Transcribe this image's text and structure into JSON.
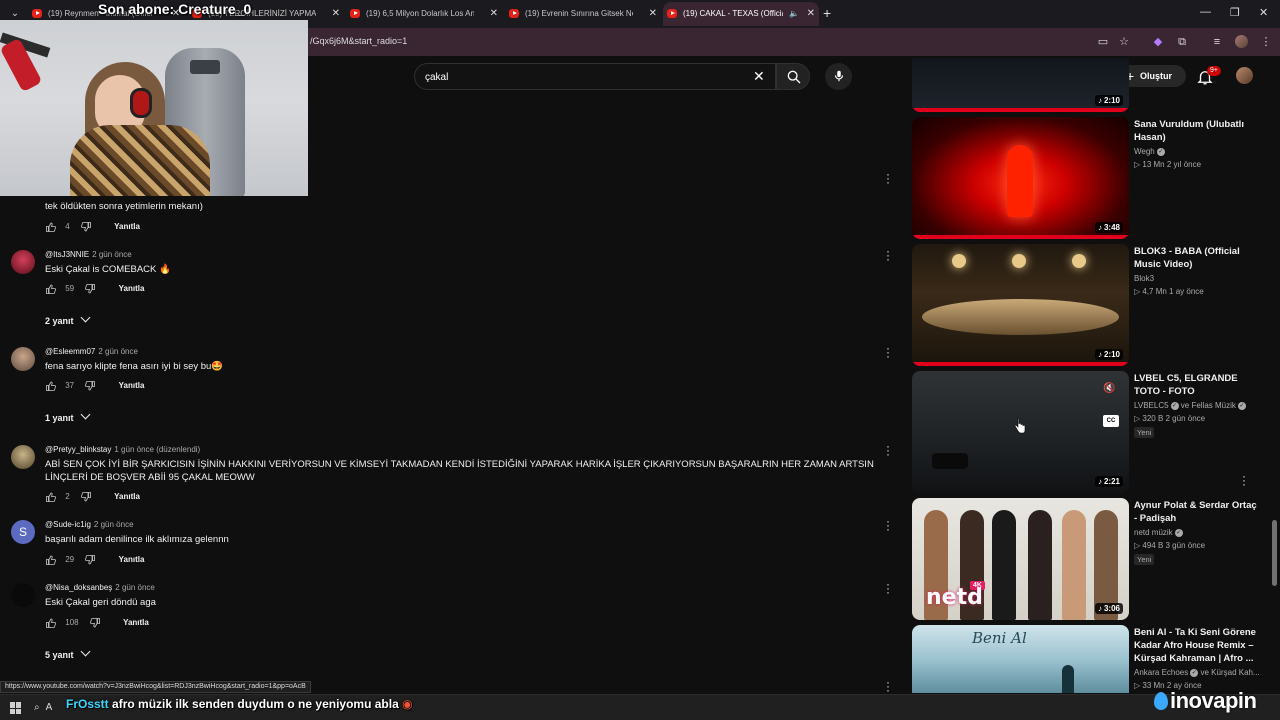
{
  "browser": {
    "tabs": [
      {
        "label": "(19) Reynmen - Ihtimal (Offici"
      },
      {
        "label": "(19) TERCİHLERİNİZİ YAPMAYI"
      },
      {
        "label": "(19) 6,5 Milyon Dolarlık Los An"
      },
      {
        "label": "(19) Evrenin Sınırına Gitsek Ne"
      },
      {
        "label": "(19) CAKAL - TEXAS (Official"
      }
    ],
    "url_tail": "/Gqx6j6M&start_radio=1",
    "status_url": "https://www.youtube.com/watch?v=J3nzBwiHcog&list=RDJ3nzBwiHcog&start_radio=1&pp=oAcB"
  },
  "overlay": {
    "subscriber_text": "Son abone: Creature_0",
    "chat_user": "FrOsstt",
    "chat_message": "afro müzik ilk senden duydum o ne yeniyomu abla",
    "watermark": "inovapin",
    "taskbar_search_prefix": "A"
  },
  "youtube": {
    "search_value": "çakal",
    "create_label": "Oluştur",
    "notifications": "9+"
  },
  "comments": [
    {
      "author": "",
      "time": "",
      "text": "tek öldükten sonra yetimlerin mekanı)",
      "likes": "4",
      "reply": "Yanıtla"
    },
    {
      "author": "@ItsJ3NNIE",
      "time": "2 gün önce",
      "text": "Eski Çakal is COMEBACK 🔥",
      "likes": "59",
      "reply": "Yanıtla",
      "replies": "2 yanıt"
    },
    {
      "author": "@Esleemm07",
      "time": "2 gün önce",
      "text": "fena sarıyo klipte fena asırı iyi bi sey bu🤩",
      "likes": "37",
      "reply": "Yanıtla",
      "replies": "1 yanıt"
    },
    {
      "author": "@Pretyy_blinkstay",
      "time": "1 gün önce (düzenlendi)",
      "text": "ABİ SEN ÇOK İYİ BİR ŞARKICISIN İŞİNİN HAKKINI VERİYORSUN VE KİMSEYİ TAKMADAN  KENDİ İSTEDİĞİNİ YAPARAK HARİKA İŞLER ÇIKARIYORSUN BAŞARALRIN HER ZAMAN ARTSIN LİNÇLERİ DE BOŞVER ABİİ  95 ÇAKAL MEOWW",
      "likes": "2",
      "reply": "Yanıtla"
    },
    {
      "author": "@Sude-ic1ig",
      "time": "2 gün önce",
      "text": "başarılı adam denilince ilk aklımıza gelennn",
      "likes": "29",
      "reply": "Yanıtla",
      "avatar_letter": "S"
    },
    {
      "author": "@Nisa_doksanbeş",
      "time": "2 gün önce",
      "text": "Eski Çakal geri döndü aga",
      "likes": "108",
      "reply": "Yanıtla",
      "replies": "5 yanıt"
    }
  ],
  "recommendations": [
    {
      "title": "",
      "channel": "",
      "meta": "",
      "duration": "2:10"
    },
    {
      "title": "Sana Vuruldum (Ulubatlı Hasan)",
      "channel": "Wegh",
      "meta": "▷ 13 Mn  2 yıl önce",
      "duration": "3:48"
    },
    {
      "title": "BLOK3 - BABA (Official Music Video)",
      "channel": "Blok3",
      "meta": "▷ 4,7 Mn  1 ay önce",
      "duration": "2:10"
    },
    {
      "title": "LVBEL C5, ELGRANDE TOTO - FOTO",
      "channel": "LVBELC5",
      "channel_extra": "ve Fellas Müzik",
      "meta": "▷ 320 B  2 gün önce",
      "duration": "2:21",
      "badge": "Yeni"
    },
    {
      "title": "Aynur Polat & Serdar Ortaç - Padişah",
      "channel": "netd müzik",
      "meta": "▷ 494 B  3 gün önce",
      "duration": "3:06",
      "badge": "Yeni",
      "thumb_brand": "netd",
      "thumb_tag": "4K"
    },
    {
      "title": "Beni Al  - Ta Ki Seni Görene Kadar Afro House Remix – Kürşad Kahraman | Afro ...",
      "channel": "Ankara Echoes",
      "channel_extra": "ve Kürşad Kah...",
      "meta": "▷ 33 Mn  2 ay önce",
      "thumb_script": "Beni Al"
    }
  ],
  "icons": [
    "search-icon",
    "mic-icon",
    "close-icon",
    "create-plus-icon",
    "bell-icon",
    "like-icon",
    "dislike-icon",
    "more-vert-icon",
    "chevron-down-icon",
    "mute-icon",
    "cc-icon",
    "windows-icon"
  ]
}
